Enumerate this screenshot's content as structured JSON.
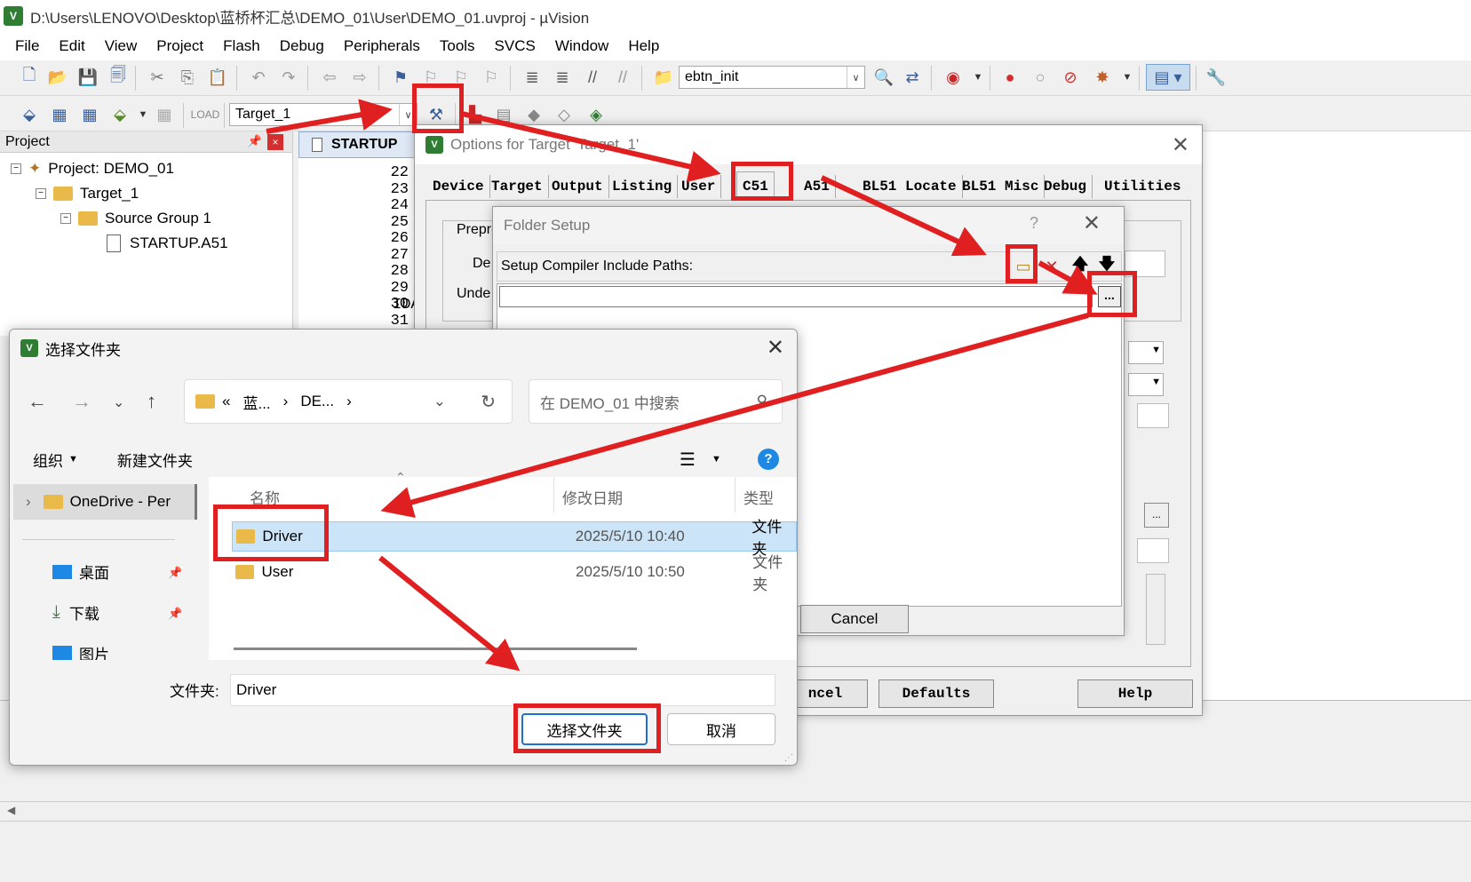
{
  "window": {
    "title": "D:\\Users\\LENOVO\\Desktop\\蓝桥杯汇总\\DEMO_01\\User\\DEMO_01.uvproj - µVision",
    "app_icon": "V"
  },
  "menu": [
    "File",
    "Edit",
    "View",
    "Project",
    "Flash",
    "Debug",
    "Peripherals",
    "Tools",
    "SVCS",
    "Window",
    "Help"
  ],
  "toolbar": {
    "find_value": "ebtn_init",
    "target_value": "Target_1"
  },
  "project_panel": {
    "header": "Project",
    "project": "Project: DEMO_01",
    "target": "Target_1",
    "group": "Source Group 1",
    "file": "STARTUP.A51"
  },
  "editor": {
    "tab": "STARTUP",
    "lines": [
      "22",
      "23",
      "24",
      "25",
      "26",
      "27",
      "28",
      "29",
      "30",
      "31"
    ],
    "code_fragment": "IDA"
  },
  "options_dialog": {
    "title": "Options for Target 'Target_1'",
    "tabs": [
      "Device",
      "Target",
      "Output",
      "Listing",
      "User",
      "C51",
      "A51",
      "BL51 Locate",
      "BL51 Misc",
      "Debug",
      "Utilities"
    ],
    "active_tab": "C51",
    "partial_labels": {
      "prepro": "Prepro",
      "de": "De",
      "unde": "Unde"
    },
    "buttons": {
      "cancel_partial": "ncel",
      "defaults": "Defaults",
      "help": "Help"
    }
  },
  "folder_setup": {
    "title": "Folder Setup",
    "help_glyph": "?",
    "label": "Setup Compiler Include Paths:",
    "browse": "...",
    "cancel": "Cancel",
    "icons": [
      "new-folder-icon",
      "delete-icon",
      "move-up-icon",
      "move-down-icon"
    ]
  },
  "folder_picker": {
    "title": "选择文件夹",
    "address": {
      "part1": "蓝...",
      "part2": "DE...",
      "prefix": "«"
    },
    "search_placeholder": "在 DEMO_01 中搜索",
    "organize": "组织",
    "new_folder": "新建文件夹",
    "nav": {
      "onedrive": "OneDrive - Per",
      "desktop": "桌面",
      "downloads": "下载",
      "pictures": "图片"
    },
    "columns": {
      "name": "名称",
      "modified": "修改日期",
      "type": "类型"
    },
    "rows": [
      {
        "name": "Driver",
        "date": "2025/5/10 10:40",
        "type": "文件夹",
        "selected": true
      },
      {
        "name": "User",
        "date": "2025/5/10 10:50",
        "type": "文件夹",
        "selected": false
      }
    ],
    "folder_label": "文件夹:",
    "folder_value": "Driver",
    "select_button": "选择文件夹",
    "cancel_button": "取消"
  },
  "colors": {
    "annotation_red": "#e02020",
    "selection": "#cce4f7",
    "folder_yellow": "#e9b94a"
  }
}
